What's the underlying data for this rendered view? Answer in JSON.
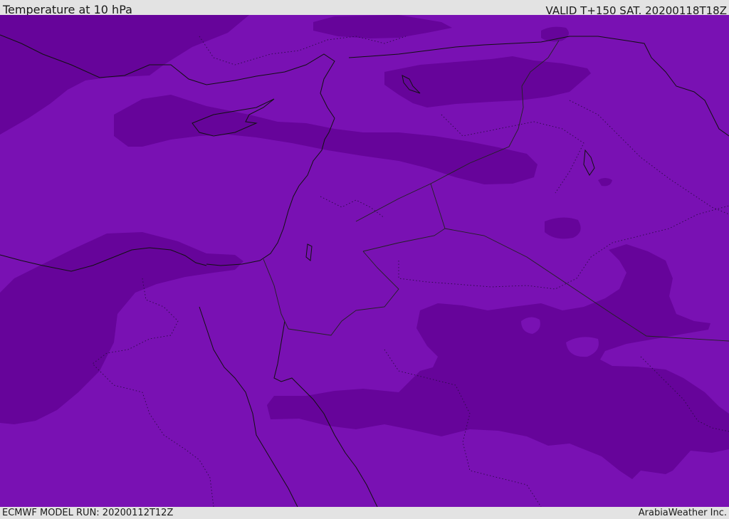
{
  "header": {
    "title": "Temperature at 10 hPa",
    "valid_time": "VALID T+150 SAT. 20200118T18Z"
  },
  "footer": {
    "model_run": "ECMWF MODEL RUN: 20200112T12Z",
    "credit": "ArabiaWeather Inc."
  },
  "map": {
    "fill_colors": {
      "base": "#7911b3",
      "dark": "#66049a",
      "coastline": "#111111",
      "border": "#222222"
    }
  }
}
